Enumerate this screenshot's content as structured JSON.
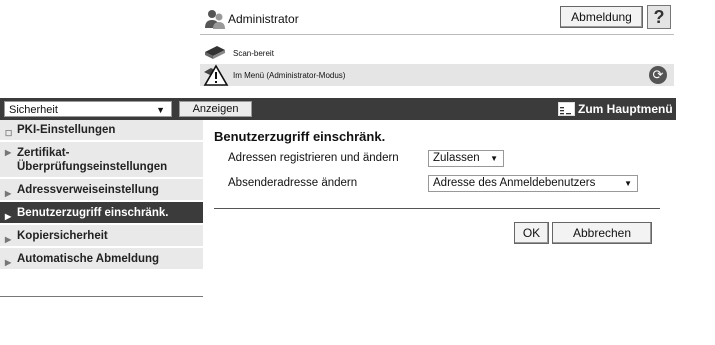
{
  "header": {
    "user_name": "Administrator",
    "logout_label": "Abmeldung",
    "help_label": "?",
    "scan_status": "Scan-bereit",
    "menu_status": "Im Menü (Administrator-Modus)"
  },
  "toolbar": {
    "category_selected": "Sicherheit",
    "show_label": "Anzeigen",
    "main_menu_label": "Zum Hauptmenü"
  },
  "sidebar": {
    "items": [
      {
        "label": "PKI-Einstellungen"
      },
      {
        "label": "Zertifikat-Überprüfungseinstellungen"
      },
      {
        "label": "Adressverweiseinstellung"
      },
      {
        "label": "Benutzerzugriff einschränk.",
        "active": true
      },
      {
        "label": "Kopiersicherheit"
      },
      {
        "label": "Automatische Abmeldung"
      }
    ]
  },
  "main": {
    "title": "Benutzerzugriff einschränk.",
    "fields": [
      {
        "label": "Adressen registrieren und ändern",
        "value": "Zulassen"
      },
      {
        "label": "Absenderadresse ändern",
        "value": "Adresse des Anmeldebenutzers"
      }
    ],
    "ok_label": "OK",
    "cancel_label": "Abbrechen"
  },
  "colors": {
    "dark_bar": "#3b3b3b",
    "sidebar_bg": "#e9e9e9",
    "active_item": "#3b3b3b"
  },
  "icons": [
    "user-icon",
    "scanner-icon",
    "warning-icon",
    "refresh-icon",
    "help-icon",
    "main-menu-icon"
  ]
}
